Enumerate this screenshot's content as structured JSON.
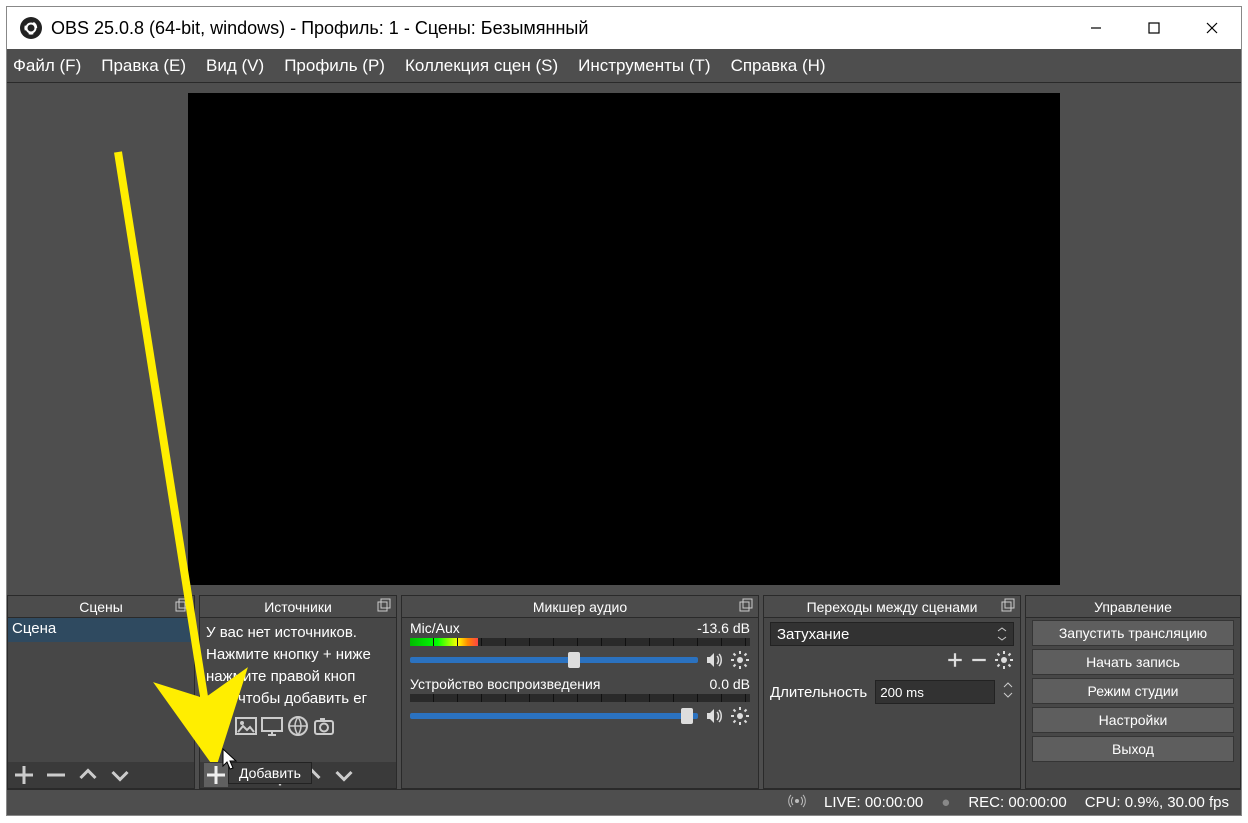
{
  "window": {
    "title": "OBS 25.0.8 (64-bit, windows) - Профиль: 1 - Сцены: Безымянный"
  },
  "menu": {
    "file": "Файл (F)",
    "edit": "Правка (E)",
    "view": "Вид (V)",
    "profile": "Профиль (P)",
    "scenecol": "Коллекция сцен (S)",
    "tools": "Инструменты (T)",
    "help": "Справка (H)"
  },
  "docks": {
    "scenes": {
      "title": "Сцены",
      "item0": "Сцена"
    },
    "sources": {
      "title": "Источники",
      "hint_l1": "У вас нет источников.",
      "hint_l2": "Нажмите кнопку + ниже",
      "hint_l3": "нажмите правой кноп",
      "hint_l4": "есь, чтобы добавить ег"
    },
    "mixer": {
      "title": "Микшер аудио",
      "ch1": {
        "name": "Mic/Aux",
        "db": "-13.6 dB"
      },
      "ch2": {
        "name": "Устройство воспроизведения",
        "db": "0.0 dB"
      }
    },
    "transitions": {
      "title": "Переходы между сценами",
      "selected": "Затухание",
      "duration_label": "Длительность",
      "duration_value": "200 ms"
    },
    "controls": {
      "title": "Управление",
      "start_stream": "Запустить трансляцию",
      "start_record": "Начать запись",
      "studio": "Режим студии",
      "settings": "Настройки",
      "exit": "Выход"
    }
  },
  "status": {
    "live": "LIVE: 00:00:00",
    "rec": "REC: 00:00:00",
    "cpu": "CPU: 0.9%, 30.00 fps"
  },
  "tooltip": "Добавить"
}
